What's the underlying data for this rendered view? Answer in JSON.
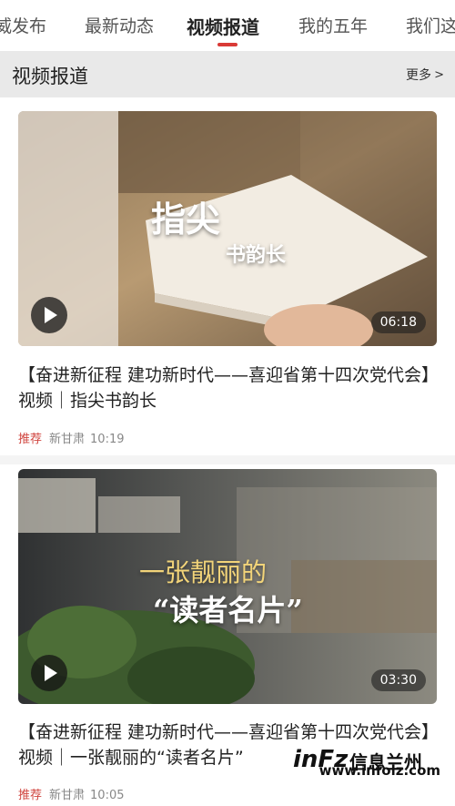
{
  "tabs": [
    {
      "label": "威发布",
      "active": false
    },
    {
      "label": "最新动态",
      "active": false
    },
    {
      "label": "视频报道",
      "active": true
    },
    {
      "label": "我的五年",
      "active": false
    },
    {
      "label": "我们这",
      "active": false
    }
  ],
  "section": {
    "title": "视频报道",
    "more_label": "更多",
    "more_chevron": ">"
  },
  "articles": [
    {
      "thumbnail_text_line1": "指尖",
      "thumbnail_text_line2": "书韵长",
      "duration": "06:18",
      "title": "【奋进新征程 建功新时代——喜迎省第十四次党代会】视频｜指尖书韵长",
      "tag": "推荐",
      "source": "新甘肃",
      "time": "10:19"
    },
    {
      "thumbnail_text_line1": "一张靓丽的",
      "thumbnail_text_line2": "“读者名片”",
      "duration": "03:30",
      "title": "【奋进新征程 建功新时代——喜迎省第十四次党代会】视频｜一张靓丽的“读者名片”",
      "tag": "推荐",
      "source": "新甘肃",
      "time": "10:05"
    }
  ],
  "watermark": {
    "logo": "inFz",
    "name": "信息兰州",
    "url": "www.infolz.com"
  },
  "colors": {
    "accent": "#d93a36",
    "section_bg": "#e9e9e9"
  }
}
